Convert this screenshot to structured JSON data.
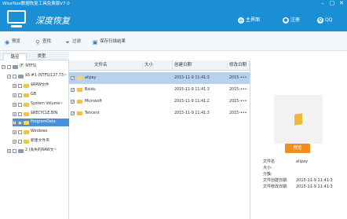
{
  "window": {
    "title": "WiseTool数据恢复工具免费版V7.0",
    "min": "–",
    "max": "□",
    "close": "✕"
  },
  "header": {
    "app_name": "深度恢复",
    "home_label": "主界面",
    "register_label": "注册",
    "qq_label": "QQ"
  },
  "toolbar": {
    "preview": "预览",
    "search": "查找",
    "filter": "过滤",
    "save_scan": "保存扫描结果"
  },
  "tabs": [
    "路径",
    "类型"
  ],
  "tree": [
    {
      "label": "(F: NTFS)",
      "expander": "−",
      "checked": false,
      "icon": "drive"
    },
    {
      "label": "$S #1 (NTFS)137.73~",
      "expander": "−",
      "checked": false,
      "icon": "drive"
    },
    {
      "label": "$RAW文件",
      "expander": "+",
      "checked": false,
      "icon": "folder"
    },
    {
      "label": "GB",
      "expander": "+",
      "checked": false,
      "icon": "folder"
    },
    {
      "label": "System Volume~",
      "expander": "+",
      "checked": false,
      "icon": "folder"
    },
    {
      "label": "$RECYCLE.BIN",
      "expander": "+",
      "checked": false,
      "icon": "folder"
    },
    {
      "label": "ProgramData",
      "expander": "+",
      "checked": true,
      "icon": "folder",
      "selected": true
    },
    {
      "label": "Windows",
      "expander": "+",
      "checked": false,
      "icon": "folder"
    },
    {
      "label": "新建文件夹",
      "expander": "+",
      "checked": false,
      "icon": "folder"
    },
    {
      "label": "2 (丢失的RAW文~",
      "expander": "+",
      "checked": false,
      "icon": "drive"
    }
  ],
  "file_list": {
    "columns": [
      "文件名",
      "大小",
      "创建日期",
      "修改日期"
    ],
    "rows": [
      {
        "name": "alipay",
        "size": "",
        "created": "2015-11-9 11:41:3",
        "modified": "2015-•••",
        "checked": true,
        "selected": true
      },
      {
        "name": "Baidu",
        "size": "",
        "created": "2015-11-9 11:41:3",
        "modified": "2015-•••",
        "checked": true,
        "selected": false
      },
      {
        "name": "Microsoft",
        "size": "",
        "created": "2015-11-9 11:41:2",
        "modified": "2015-•••",
        "checked": true,
        "selected": false
      },
      {
        "name": "Tencent",
        "size": "",
        "created": "2015-11-9 11:41:3",
        "modified": "2015-•••",
        "checked": true,
        "selected": false
      }
    ]
  },
  "preview": {
    "button": "预览",
    "info": [
      {
        "label": "文件名",
        "value": "alipay"
      },
      {
        "label": "大小:",
        "value": ""
      },
      {
        "label": "分簇:",
        "value": ""
      },
      {
        "label": "文件创建日期:",
        "value": "2015-11-9 11:41:3"
      },
      {
        "label": "文件修改日期:",
        "value": "2015-11-9 11:41:3"
      }
    ]
  },
  "colors": {
    "brand": "#1a8fd6",
    "selection": "#4a90d9",
    "row_selection": "#b7d1ee",
    "accent_button": "#f28c1b"
  }
}
